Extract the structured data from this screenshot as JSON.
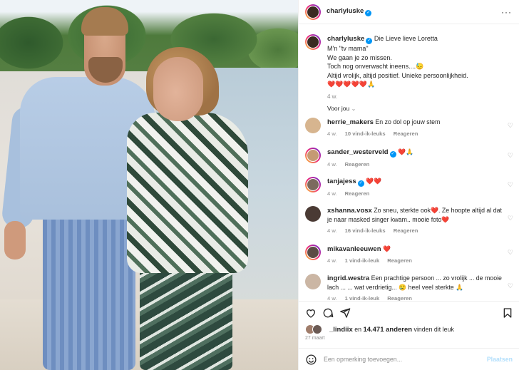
{
  "post": {
    "username": "charlyluske",
    "verified_mark": "✓",
    "more_icon": "more-horizontal-icon"
  },
  "caption": {
    "username": "charlyluske",
    "lines": [
      "Die Lieve lieve Loretta",
      "M'n \"tv mama\"",
      "We gaan je zo missen.",
      "Toch nog onverwacht ineens....",
      "Altijd vrolijk, altijd positief. Unieke persoonlijkheid."
    ],
    "emoji_line3": "😓",
    "hearts": "❤️❤️❤️❤️❤️",
    "hands": "🙏",
    "age": "4 w."
  },
  "sort": {
    "label": "Voor jou"
  },
  "comments": [
    {
      "user": "herrie_makers",
      "verified": false,
      "text": "En zo dol op jouw stem",
      "age": "4 w.",
      "likes": "10 vind-ik-leuks",
      "reply": "Reageren"
    },
    {
      "user": "sander_westerveld",
      "verified": true,
      "text": "❤️🙏",
      "age": "4 w.",
      "likes": "",
      "reply": "Reageren"
    },
    {
      "user": "tanjajess",
      "verified": true,
      "text": "❤️❤️",
      "age": "4 w.",
      "likes": "",
      "reply": "Reageren"
    },
    {
      "user": "xshanna.vosx",
      "verified": false,
      "text": "Zo sneu, sterkte ook❤️. Ze hoopte altijd al dat je naar masked singer kwam.. mooie foto❤️",
      "age": "4 w.",
      "likes": "16 vind-ik-leuks",
      "reply": "Reageren"
    },
    {
      "user": "mikavanleeuwen",
      "verified": false,
      "text": "❤️",
      "age": "4 w.",
      "likes": "1 vind-ik-leuk",
      "reply": "Reageren"
    },
    {
      "user": "ingrid.westra",
      "verified": false,
      "text": "Een prachtige persoon ... zo vrolijk ... de mooie lach ... ... wat verdrietig... 😢 heel veel sterkte 🙏",
      "age": "4 w.",
      "likes": "1 vind-ik-leuk",
      "reply": "Reageren"
    }
  ],
  "likes": {
    "user": "_lindiix",
    "connector": "en",
    "count": "14.471 anderen",
    "suffix": "vinden dit leuk"
  },
  "date": "27 maart",
  "add_comment": {
    "placeholder": "Een opmerking toevoegen...",
    "post_label": "Plaatsen"
  },
  "colors": {
    "accent": "#0095f6",
    "heart": "#ed4956",
    "muted": "#8e8e8e",
    "post_disabled": "#b2dffc"
  }
}
